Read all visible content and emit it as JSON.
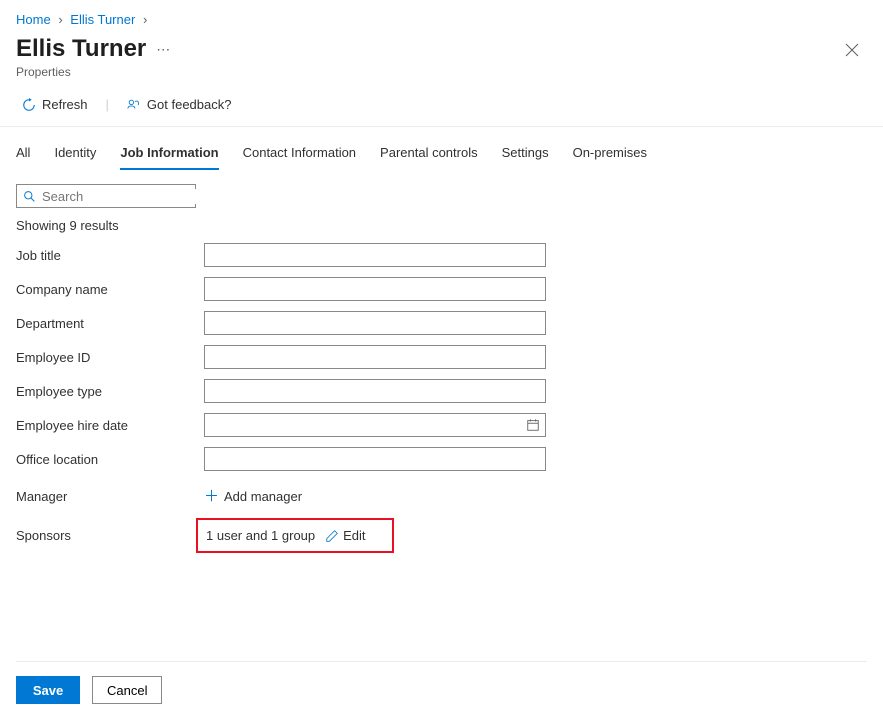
{
  "breadcrumb": {
    "home": "Home",
    "user": "Ellis Turner"
  },
  "header": {
    "title": "Ellis Turner",
    "subtitle": "Properties"
  },
  "toolbar": {
    "refresh_label": "Refresh",
    "feedback_label": "Got feedback?"
  },
  "tabs": {
    "all": "All",
    "identity": "Identity",
    "job": "Job Information",
    "contact": "Contact Information",
    "parental": "Parental controls",
    "settings": "Settings",
    "onprem": "On-premises"
  },
  "search": {
    "placeholder": "Search",
    "value": "",
    "results_text": "Showing 9 results"
  },
  "fields": {
    "job_title": {
      "label": "Job title",
      "value": ""
    },
    "company_name": {
      "label": "Company name",
      "value": ""
    },
    "department": {
      "label": "Department",
      "value": ""
    },
    "employee_id": {
      "label": "Employee ID",
      "value": ""
    },
    "employee_type": {
      "label": "Employee type",
      "value": ""
    },
    "hire_date": {
      "label": "Employee hire date",
      "value": ""
    },
    "office_location": {
      "label": "Office location",
      "value": ""
    },
    "manager": {
      "label": "Manager",
      "action": "Add manager"
    },
    "sponsors": {
      "label": "Sponsors",
      "value": "1 user and 1 group",
      "edit": "Edit"
    }
  },
  "footer": {
    "save": "Save",
    "cancel": "Cancel"
  }
}
